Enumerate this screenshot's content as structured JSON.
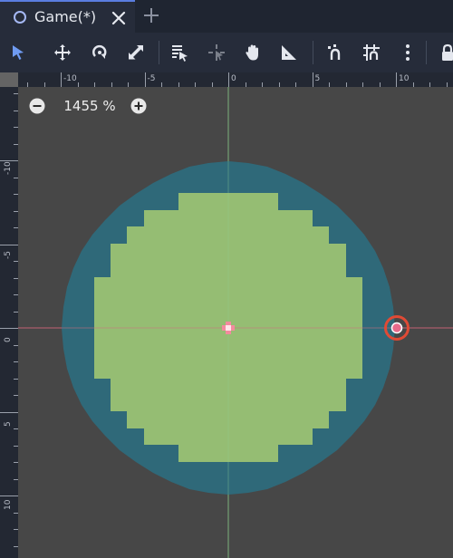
{
  "tab": {
    "title": "Game(*)",
    "icon": "scene-node-icon",
    "active": true,
    "accent_color": "#5a7de0"
  },
  "toolbar": {
    "tools": [
      "select-tool-icon",
      "move-tool-icon",
      "rotate-tool-icon",
      "scale-tool-icon",
      "list-select-icon",
      "pivot-tool-icon",
      "pan-tool-icon",
      "ruler-tool-icon",
      "smart-snap-icon",
      "grid-snap-icon",
      "more-options-icon",
      "lock-icon"
    ],
    "active_tool": "select-tool-icon"
  },
  "ruler": {
    "top_labels": [
      "-10",
      "-5",
      "0",
      "5",
      "10"
    ],
    "left_labels": [
      "-10",
      "-5",
      "0",
      "5",
      "10"
    ]
  },
  "viewport": {
    "zoom_label": "1455 %",
    "background_color": "#474747",
    "circle_outline_color": "#2e6b7c",
    "circle_fill_color": "#95bd73",
    "x_axis_color": "#c15b6e",
    "y_axis_color": "#7fbf7f",
    "handle_color": "#e04a35"
  }
}
